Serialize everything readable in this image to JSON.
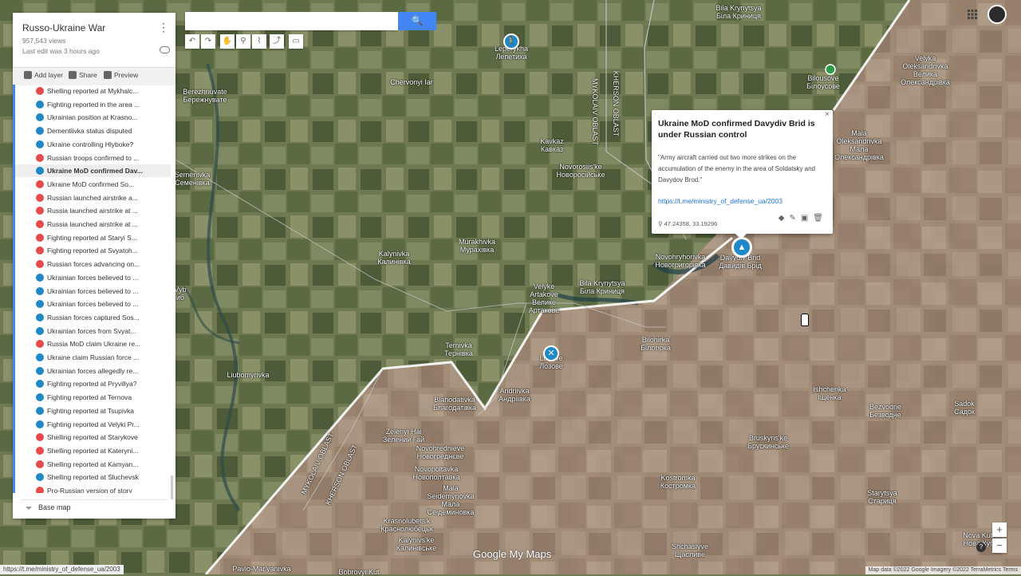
{
  "panel": {
    "title": "Russo-Ukraine War",
    "views": "957,543 views",
    "last_edit": "Last edit was 3 hours ago",
    "add_layer": "Add layer",
    "share": "Share",
    "preview": "Preview",
    "base_map": "Base map",
    "items": [
      {
        "label": "Shelling reported at Mykhalc...",
        "color": "#e84a4a",
        "icon": "explosion-icon"
      },
      {
        "label": "Fighting reported in the area ...",
        "color": "#1e88c8",
        "icon": "crossed-swords-icon"
      },
      {
        "label": "Ukrainian position at Krasno...",
        "color": "#1e88c8",
        "icon": "castle-icon"
      },
      {
        "label": "Dementiivka status disputed",
        "color": "#1e88c8",
        "icon": "question-icon"
      },
      {
        "label": "Ukraine controlling Hlyboke?",
        "color": "#1e88c8",
        "icon": "question-icon"
      },
      {
        "label": "Russian troops confirmed to ...",
        "color": "#e84a4a",
        "icon": "walker-icon"
      },
      {
        "label": "Ukraine MoD confirmed Dav...",
        "color": "#1e88c8",
        "icon": "triangle-icon",
        "selected": true
      },
      {
        "label": "Ukraine MoD confirmed So...",
        "color": "#e84a4a",
        "icon": "flag-icon"
      },
      {
        "label": "Russian launched airstrike a...",
        "color": "#e84a4a",
        "icon": "airplane-icon"
      },
      {
        "label": "Russia launched airstrike at ...",
        "color": "#e84a4a",
        "icon": "airplane-icon"
      },
      {
        "label": "Russia launched airstrike at ...",
        "color": "#e84a4a",
        "icon": "airplane-icon"
      },
      {
        "label": "Fighting reported at Staryi S...",
        "color": "#e84a4a",
        "icon": "question-icon"
      },
      {
        "label": "Fighting reported at Svyatoh...",
        "color": "#e84a4a",
        "icon": "question-icon"
      },
      {
        "label": "Russian forces advancing on...",
        "color": "#e84a4a",
        "icon": "crossed-swords-icon"
      },
      {
        "label": "Ukrainian forces believed to ...",
        "color": "#1e88c8",
        "icon": "flag-icon"
      },
      {
        "label": "Ukrainian forces believed to ...",
        "color": "#1e88c8",
        "icon": "flag-icon"
      },
      {
        "label": "Ukrainian forces believed to ...",
        "color": "#1e88c8",
        "icon": "flag-icon"
      },
      {
        "label": "Russian forces captured Sos...",
        "color": "#1e88c8",
        "icon": "flag-icon"
      },
      {
        "label": "Ukrainian forces from Svyat...",
        "color": "#1e88c8",
        "icon": "flag-icon"
      },
      {
        "label": "Russia MoD claim Ukraine re...",
        "color": "#e84a4a",
        "icon": "castle-icon"
      },
      {
        "label": "Ukraine claim Russian force ...",
        "color": "#1e88c8",
        "icon": "flag-icon"
      },
      {
        "label": "Ukrainian forces allegedly re...",
        "color": "#1e88c8",
        "icon": "flag-icon"
      },
      {
        "label": "Fighting reported at Pryvillya?",
        "color": "#1e88c8",
        "icon": "crossed-swords-icon"
      },
      {
        "label": "Fighting reported at Ternova",
        "color": "#1e88c8",
        "icon": "crossed-swords-icon"
      },
      {
        "label": "Fighting reported at Tsupivka",
        "color": "#1e88c8",
        "icon": "crossed-swords-icon"
      },
      {
        "label": "Fighting reported at Velyki Pr...",
        "color": "#1e88c8",
        "icon": "crossed-swords-icon"
      },
      {
        "label": "Shelling reported at Starykove",
        "color": "#e84a4a",
        "icon": "explosion-icon"
      },
      {
        "label": "Shelling reported at Kateryni...",
        "color": "#e84a4a",
        "icon": "explosion-icon"
      },
      {
        "label": "Shelling reported at Kamyan...",
        "color": "#e84a4a",
        "icon": "explosion-icon"
      },
      {
        "label": "Shelling reported at Sluchevsk",
        "color": "#1e88c8",
        "icon": "explosion-icon"
      },
      {
        "label": "Pro-Russian version of story",
        "color": "#e84a4a",
        "icon": "flag-icon"
      }
    ]
  },
  "toolbar": {
    "search_placeholder": "",
    "search_icon": "magnifier-icon"
  },
  "popup": {
    "title": "Ukraine MoD confirmed Davydiv Brid is under Russian control",
    "description": "\"Army aircraft carried out two more strikes on the accumulation of the enemy in the area of Soldatsky and Davydov Brod.\"",
    "link": "https://t.me/ministry_of_defense_ua/2003",
    "coords": "47.24358, 33.19296"
  },
  "map_labels": [
    {
      "text": "Bila Krynytsya\nБіла Криниця"
    },
    {
      "text": "Velyka\nOleksandrivka\nВелика\nОлександрівка"
    },
    {
      "text": "Bilousove\nБілоусове"
    },
    {
      "text": "Leperykha\nЛепетиха"
    },
    {
      "text": "Berezhnuvate\nБережнувате"
    },
    {
      "text": "Chervonyi Iar"
    },
    {
      "text": "MYKOLAIV OBLAST"
    },
    {
      "text": "KHERSON OBLAST"
    },
    {
      "text": "Kavkaz\nКавказ"
    },
    {
      "text": "Novorosiis'ke\nНоворосійське"
    },
    {
      "text": "Mala\nOleksandrivka\nМала\nОлександрівка"
    },
    {
      "text": "Semenivka\nСеменівка"
    },
    {
      "text": "Murakhivka\nМурахівка"
    },
    {
      "text": "Kalynivka\nКалинівка"
    },
    {
      "text": "Novohryhorivka\nНовогригорівка"
    },
    {
      "text": "Davydiv Brid\nДавидів Брід"
    },
    {
      "text": "Velyke\nArtakove\nВелике\nАртакове"
    },
    {
      "text": "Bila Krynytsya\nБіла Криниця"
    },
    {
      "text": "Bilohirka\nБілогірка"
    },
    {
      "text": "Ternivka\nТернівка"
    },
    {
      "text": "Lozove\nЛозове"
    },
    {
      "text": "Liubomyrivka"
    },
    {
      "text": "Blahodativka\nБлагодатівка"
    },
    {
      "text": "Andriivka\nАндріївка"
    },
    {
      "text": "Ishchenka\nІщенка"
    },
    {
      "text": "Sadok\nСадок"
    },
    {
      "text": "Bezvodne\nБезводне"
    },
    {
      "text": "Zelenyi Hai\nЗелений Гай"
    },
    {
      "text": "Novohrednieve\nНовогреднєве"
    },
    {
      "text": "Novopoltavka\nНовополтавка"
    },
    {
      "text": "Mala\nSeidemynovka\nМала\nСеідеминовка"
    },
    {
      "text": "Bruskyns'ke\nБрускинське"
    },
    {
      "text": "Kostromka\nКостромка"
    },
    {
      "text": "Starytsya\nСтариця"
    },
    {
      "text": "Krasnolubets'k\nКраснолюбецьк"
    },
    {
      "text": "Kalynivs'ke\nКалинівське"
    },
    {
      "text": "Shchaslyve\nЩасливе"
    },
    {
      "text": "Nova Kub\nНова Куб"
    },
    {
      "text": "Pavlo-Mar'yanivka"
    },
    {
      "text": "Bobrovyi Kut"
    },
    {
      "text": "MYKOLAIV OBLAST"
    },
    {
      "text": "KHERSON OBLAST"
    },
    {
      "text": "Vyb\nиб"
    }
  ],
  "status_url": "https://t.me/ministry_of_defense_ua/2003",
  "attribution": "Map data ©2022 Google Imagery ©2022 TerraMetrics   Terms",
  "logo_text": "Google My Maps",
  "zoom": {
    "in": "+",
    "out": "−"
  },
  "help": "?"
}
